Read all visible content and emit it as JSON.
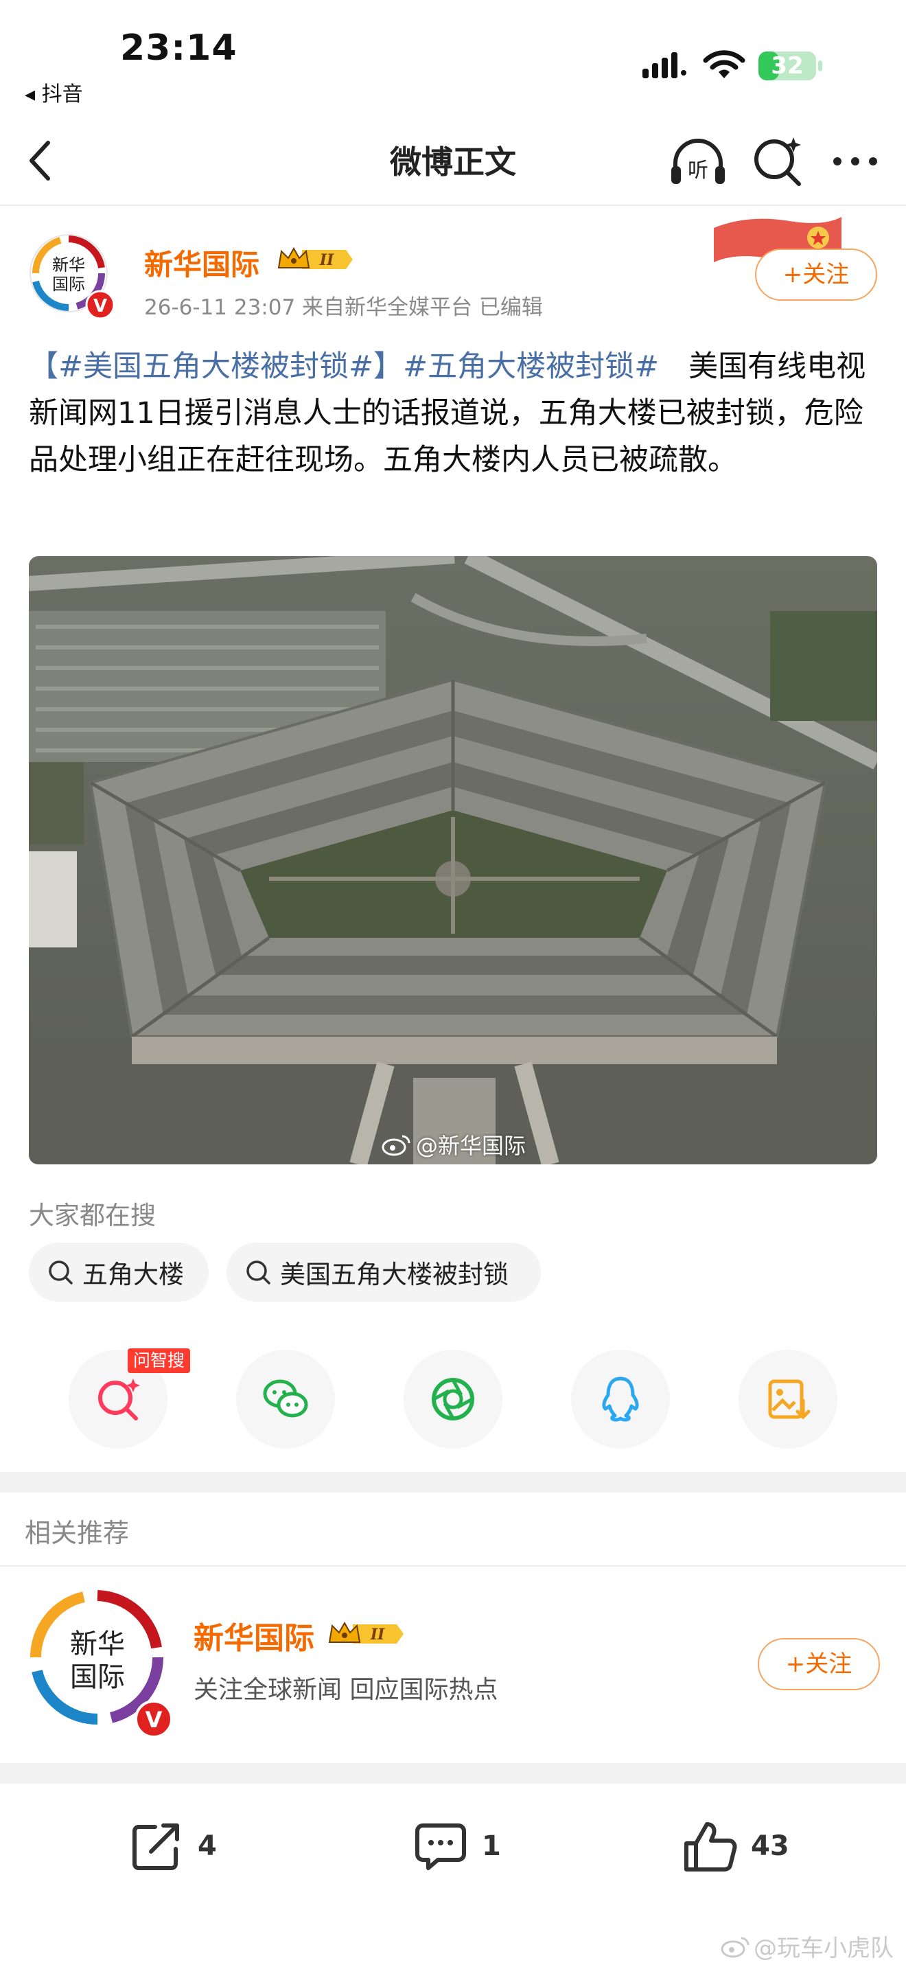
{
  "status_bar": {
    "time": "23:14",
    "back_app": "◂ 抖音",
    "battery": "32"
  },
  "nav": {
    "title": "微博正文",
    "listen_label": "听"
  },
  "post": {
    "author_name": "新华国际",
    "badge_level": "II",
    "meta": "26-6-11 23:07  来自新华全媒平台  已编辑",
    "follow_label": "+关注",
    "tag_1": "【#美国五角大楼被封锁#】",
    "tag_2": "#五角大楼被封锁#",
    "text": "　美国有线电视新闻网11日援引消息人士的话报道说，五角大楼已被封锁，危险品处理小组正在赶往现场。五角大楼内人员已被疏散。",
    "image_watermark": "@新华国际"
  },
  "avatar": {
    "line1": "新华",
    "line2": "国际",
    "verified": "V"
  },
  "search": {
    "heading": "大家都在搜",
    "chips": [
      "五角大楼",
      "美国五角大楼被封锁"
    ]
  },
  "share": {
    "ai_badge": "问智搜"
  },
  "related": {
    "title": "相关推荐",
    "name": "新华国际",
    "desc": "关注全球新闻 回应国际热点",
    "follow_label": "+关注"
  },
  "actions": {
    "repost_count": "4",
    "comment_count": "1",
    "like_count": "43"
  },
  "bottom_watermark": "@玩车小虎队",
  "colors": {
    "accent": "#f56a00",
    "topic": "#4a6fa5",
    "ai_badge": "#ff3b30"
  }
}
